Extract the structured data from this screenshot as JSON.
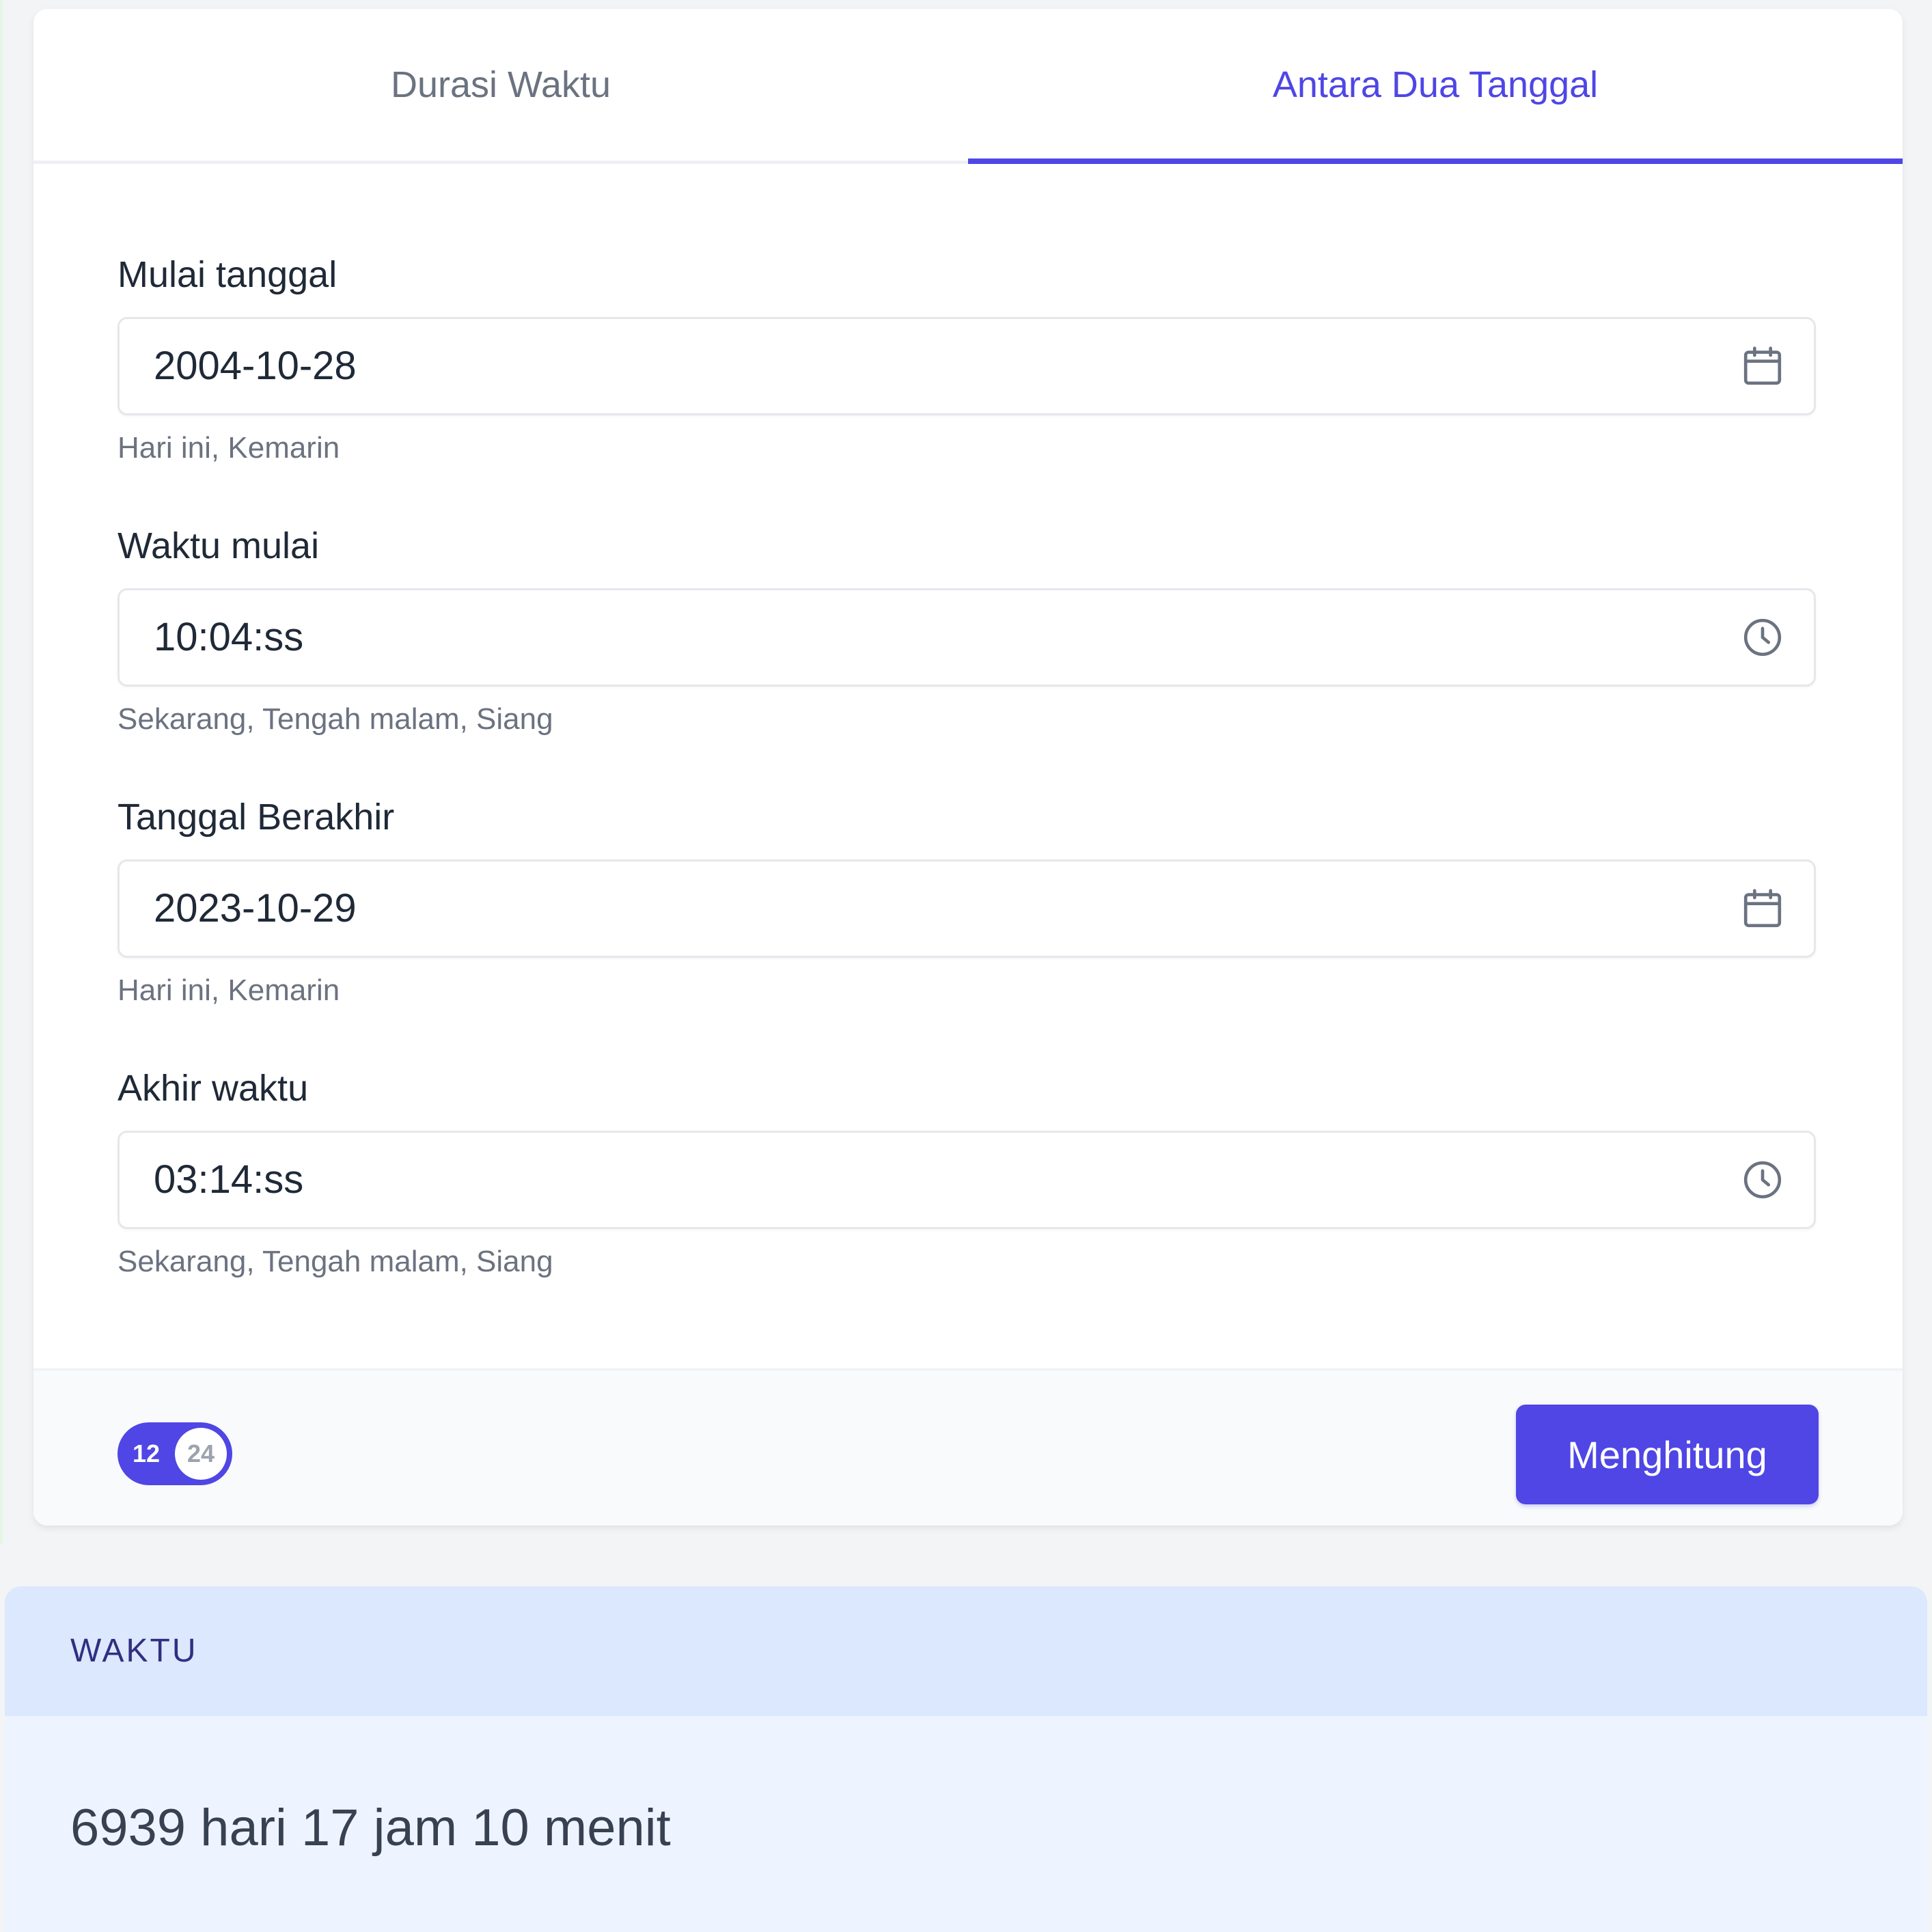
{
  "tabs": [
    {
      "label": "Durasi Waktu",
      "active": false
    },
    {
      "label": "Antara Dua Tanggal",
      "active": true
    }
  ],
  "form": {
    "start_date": {
      "label": "Mulai tanggal",
      "value": "2004-10-28",
      "icon": "calendar-icon",
      "hint": "Hari ini, Kemarin"
    },
    "start_time": {
      "label": "Waktu mulai",
      "value": "10:04:ss",
      "icon": "clock-icon",
      "hint": "Sekarang, Tengah malam, Siang"
    },
    "end_date": {
      "label": "Tanggal Berakhir",
      "value": "2023-10-29",
      "icon": "calendar-icon",
      "hint": "Hari ini, Kemarin"
    },
    "end_time": {
      "label": "Akhir waktu",
      "value": "03:14:ss",
      "icon": "clock-icon",
      "hint": "Sekarang, Tengah malam, Siang"
    }
  },
  "footer": {
    "toggle": {
      "left_label": "12",
      "right_label": "24",
      "state": "12"
    },
    "calculate_label": "Menghitung"
  },
  "result": {
    "title": "WAKTU",
    "value": "6939 hari 17 jam 10 menit"
  },
  "colors": {
    "accent": "#4f46e5",
    "result_header_bg": "#dbe8fd",
    "result_body_bg": "#eef4ff",
    "page_bg": "#f3f4f6"
  }
}
